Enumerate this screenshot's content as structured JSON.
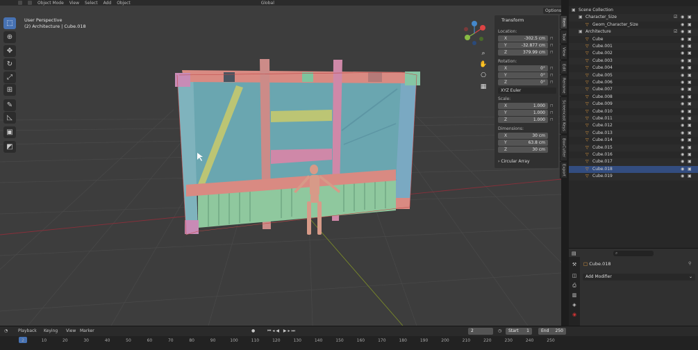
{
  "header": {
    "menus": [
      "Object Mode",
      "View",
      "Select",
      "Add",
      "Object"
    ],
    "transform_orientation": "Global",
    "options_label": "Options"
  },
  "viewport": {
    "label_line1": "User Perspective",
    "label_line2": "(2) Architecture | Cube.018"
  },
  "npanel": {
    "panel_title": "Transform",
    "location_label": "Location:",
    "location": [
      {
        "axis": "X",
        "value": "-302.5 cm"
      },
      {
        "axis": "Y",
        "value": "-32.877 cm"
      },
      {
        "axis": "Z",
        "value": "379.99 cm"
      }
    ],
    "rotation_label": "Rotation:",
    "rotation": [
      {
        "axis": "X",
        "value": "0°"
      },
      {
        "axis": "Y",
        "value": "0°"
      },
      {
        "axis": "Z",
        "value": "0°"
      }
    ],
    "rotation_mode": "XYZ Euler",
    "scale_label": "Scale:",
    "scale": [
      {
        "axis": "X",
        "value": "1.000"
      },
      {
        "axis": "Y",
        "value": "1.000"
      },
      {
        "axis": "Z",
        "value": "1.000"
      }
    ],
    "dimensions_label": "Dimensions:",
    "dimensions": [
      {
        "axis": "X",
        "value": "30 cm"
      },
      {
        "axis": "Y",
        "value": "63.8 cm"
      },
      {
        "axis": "Z",
        "value": "30 cm"
      }
    ],
    "circular_array": "Circular Array"
  },
  "vtabs": [
    "Item",
    "Tool",
    "View",
    "Edit",
    "Rename",
    "Screencast Keys",
    "BoxCutter",
    "Export"
  ],
  "outliner": {
    "scene_collection": "Scene Collection",
    "collections": [
      {
        "name": "Character_Size",
        "children": [
          "Geom_Character_Size"
        ]
      },
      {
        "name": "Architecture",
        "children": [
          "Cube",
          "Cube.001",
          "Cube.002",
          "Cube.003",
          "Cube.004",
          "Cube.005",
          "Cube.006",
          "Cube.007",
          "Cube.008",
          "Cube.009",
          "Cube.010",
          "Cube.011",
          "Cube.012",
          "Cube.013",
          "Cube.014",
          "Cube.015",
          "Cube.016",
          "Cube.017",
          "Cube.018",
          "Cube.019"
        ]
      }
    ],
    "selected": "Cube.018"
  },
  "properties": {
    "object_name": "Cube.018",
    "add_modifier": "Add Modifier"
  },
  "timeline": {
    "menus": [
      "Playback",
      "Keying",
      "View",
      "Marker"
    ],
    "current_frame": "2",
    "start_label": "Start",
    "start": "1",
    "end_label": "End",
    "end": "250",
    "ticks": [
      "2",
      "10",
      "20",
      "30",
      "40",
      "50",
      "60",
      "70",
      "80",
      "90",
      "100",
      "110",
      "120",
      "130",
      "140",
      "150",
      "160",
      "170",
      "180",
      "190",
      "200",
      "210",
      "220",
      "230",
      "240",
      "250"
    ]
  },
  "colors": {
    "selection_blue": "#4772b3",
    "outliner_selected": "#334d80",
    "mesh_icon": "#55c7a8",
    "object_icon": "#e8a040"
  }
}
